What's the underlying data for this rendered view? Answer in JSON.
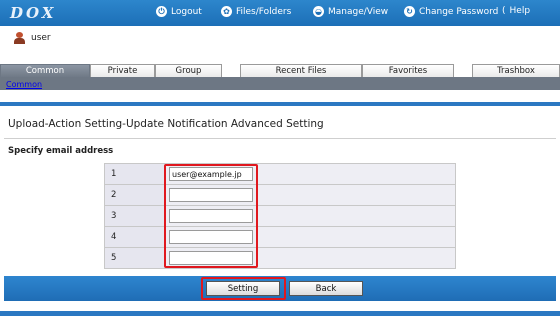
{
  "app": {
    "logo": "DOX"
  },
  "nav": {
    "logout": "Logout",
    "files_folders": "Files/Folders",
    "manage_view": "Manage/View",
    "change_password": "Change Password",
    "help": "Help"
  },
  "user": {
    "name": "user"
  },
  "tabs": [
    {
      "label": "Common",
      "active": true
    },
    {
      "label": "Private"
    },
    {
      "label": "Group"
    },
    {
      "label": "Recent Files"
    },
    {
      "label": "Favorites"
    },
    {
      "label": "Trashbox"
    }
  ],
  "breadcrumb": "Common",
  "page": {
    "title": "Upload-Action Setting-Update Notification Advanced Setting",
    "subtitle": "Specify email address"
  },
  "emails": [
    {
      "index": "1",
      "value": "user@example.jp"
    },
    {
      "index": "2",
      "value": ""
    },
    {
      "index": "3",
      "value": ""
    },
    {
      "index": "4",
      "value": ""
    },
    {
      "index": "5",
      "value": ""
    }
  ],
  "buttons": {
    "setting": "Setting",
    "back": "Back"
  },
  "colors": {
    "header_blue": "#1c6fb7",
    "highlight_red": "#e0181e",
    "tab_active": "#6d7784"
  }
}
